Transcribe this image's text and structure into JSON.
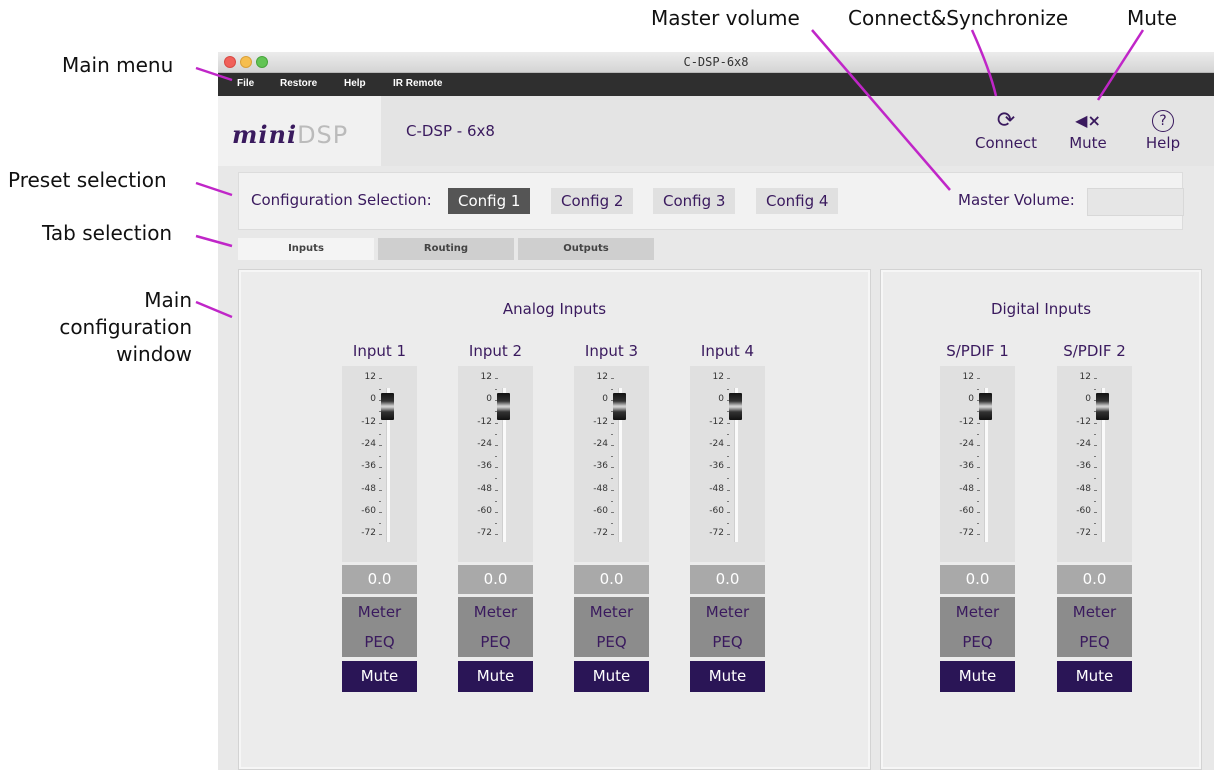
{
  "annotations": {
    "main_menu": "Main menu",
    "preset_selection": "Preset selection",
    "tab_selection": "Tab selection",
    "main_config_line1": "Main",
    "main_config_line2": "configuration",
    "main_config_line3": "window",
    "master_volume": "Master volume",
    "connect_sync": "Connect&Synchronize",
    "mute": "Mute"
  },
  "window": {
    "title": "C-DSP-6x8"
  },
  "menu": {
    "items": [
      "File",
      "Restore",
      "Help",
      "IR Remote"
    ]
  },
  "header": {
    "logo_mini": "mini",
    "logo_dsp": "DSP",
    "device_name": "C-DSP - 6x8",
    "buttons": [
      {
        "label": "Connect",
        "icon": "refresh-icon",
        "glyph": "⟳"
      },
      {
        "label": "Mute",
        "icon": "speaker-mute-icon",
        "glyph": "◀×"
      },
      {
        "label": "Help",
        "icon": "help-icon",
        "glyph": "?"
      }
    ]
  },
  "config": {
    "label": "Configuration Selection:",
    "options": [
      "Config 1",
      "Config 2",
      "Config 3",
      "Config 4"
    ],
    "selected": "Config 1",
    "master_volume_label": "Master Volume:",
    "master_volume_value": ""
  },
  "tabs": {
    "items": [
      "Inputs",
      "Routing",
      "Outputs"
    ],
    "selected": "Inputs"
  },
  "analog": {
    "title": "Analog Inputs",
    "channels": [
      {
        "name": "Input 1",
        "value": "0.0",
        "meter": "Meter",
        "peq": "PEQ",
        "mute": "Mute"
      },
      {
        "name": "Input 2",
        "value": "0.0",
        "meter": "Meter",
        "peq": "PEQ",
        "mute": "Mute"
      },
      {
        "name": "Input 3",
        "value": "0.0",
        "meter": "Meter",
        "peq": "PEQ",
        "mute": "Mute"
      },
      {
        "name": "Input 4",
        "value": "0.0",
        "meter": "Meter",
        "peq": "PEQ",
        "mute": "Mute"
      }
    ]
  },
  "digital": {
    "title": "Digital Inputs",
    "channels": [
      {
        "name": "S/PDIF 1",
        "value": "0.0",
        "meter": "Meter",
        "peq": "PEQ",
        "mute": "Mute"
      },
      {
        "name": "S/PDIF 2",
        "value": "0.0",
        "meter": "Meter",
        "peq": "PEQ",
        "mute": "Mute"
      }
    ]
  },
  "fader_scale": [
    "12",
    "0",
    "-12",
    "-24",
    "-36",
    "-48",
    "-60",
    "-72"
  ],
  "colors": {
    "accent": "#3a1a5e",
    "mute_bg": "#2a1556",
    "callout": "#c026c8"
  }
}
